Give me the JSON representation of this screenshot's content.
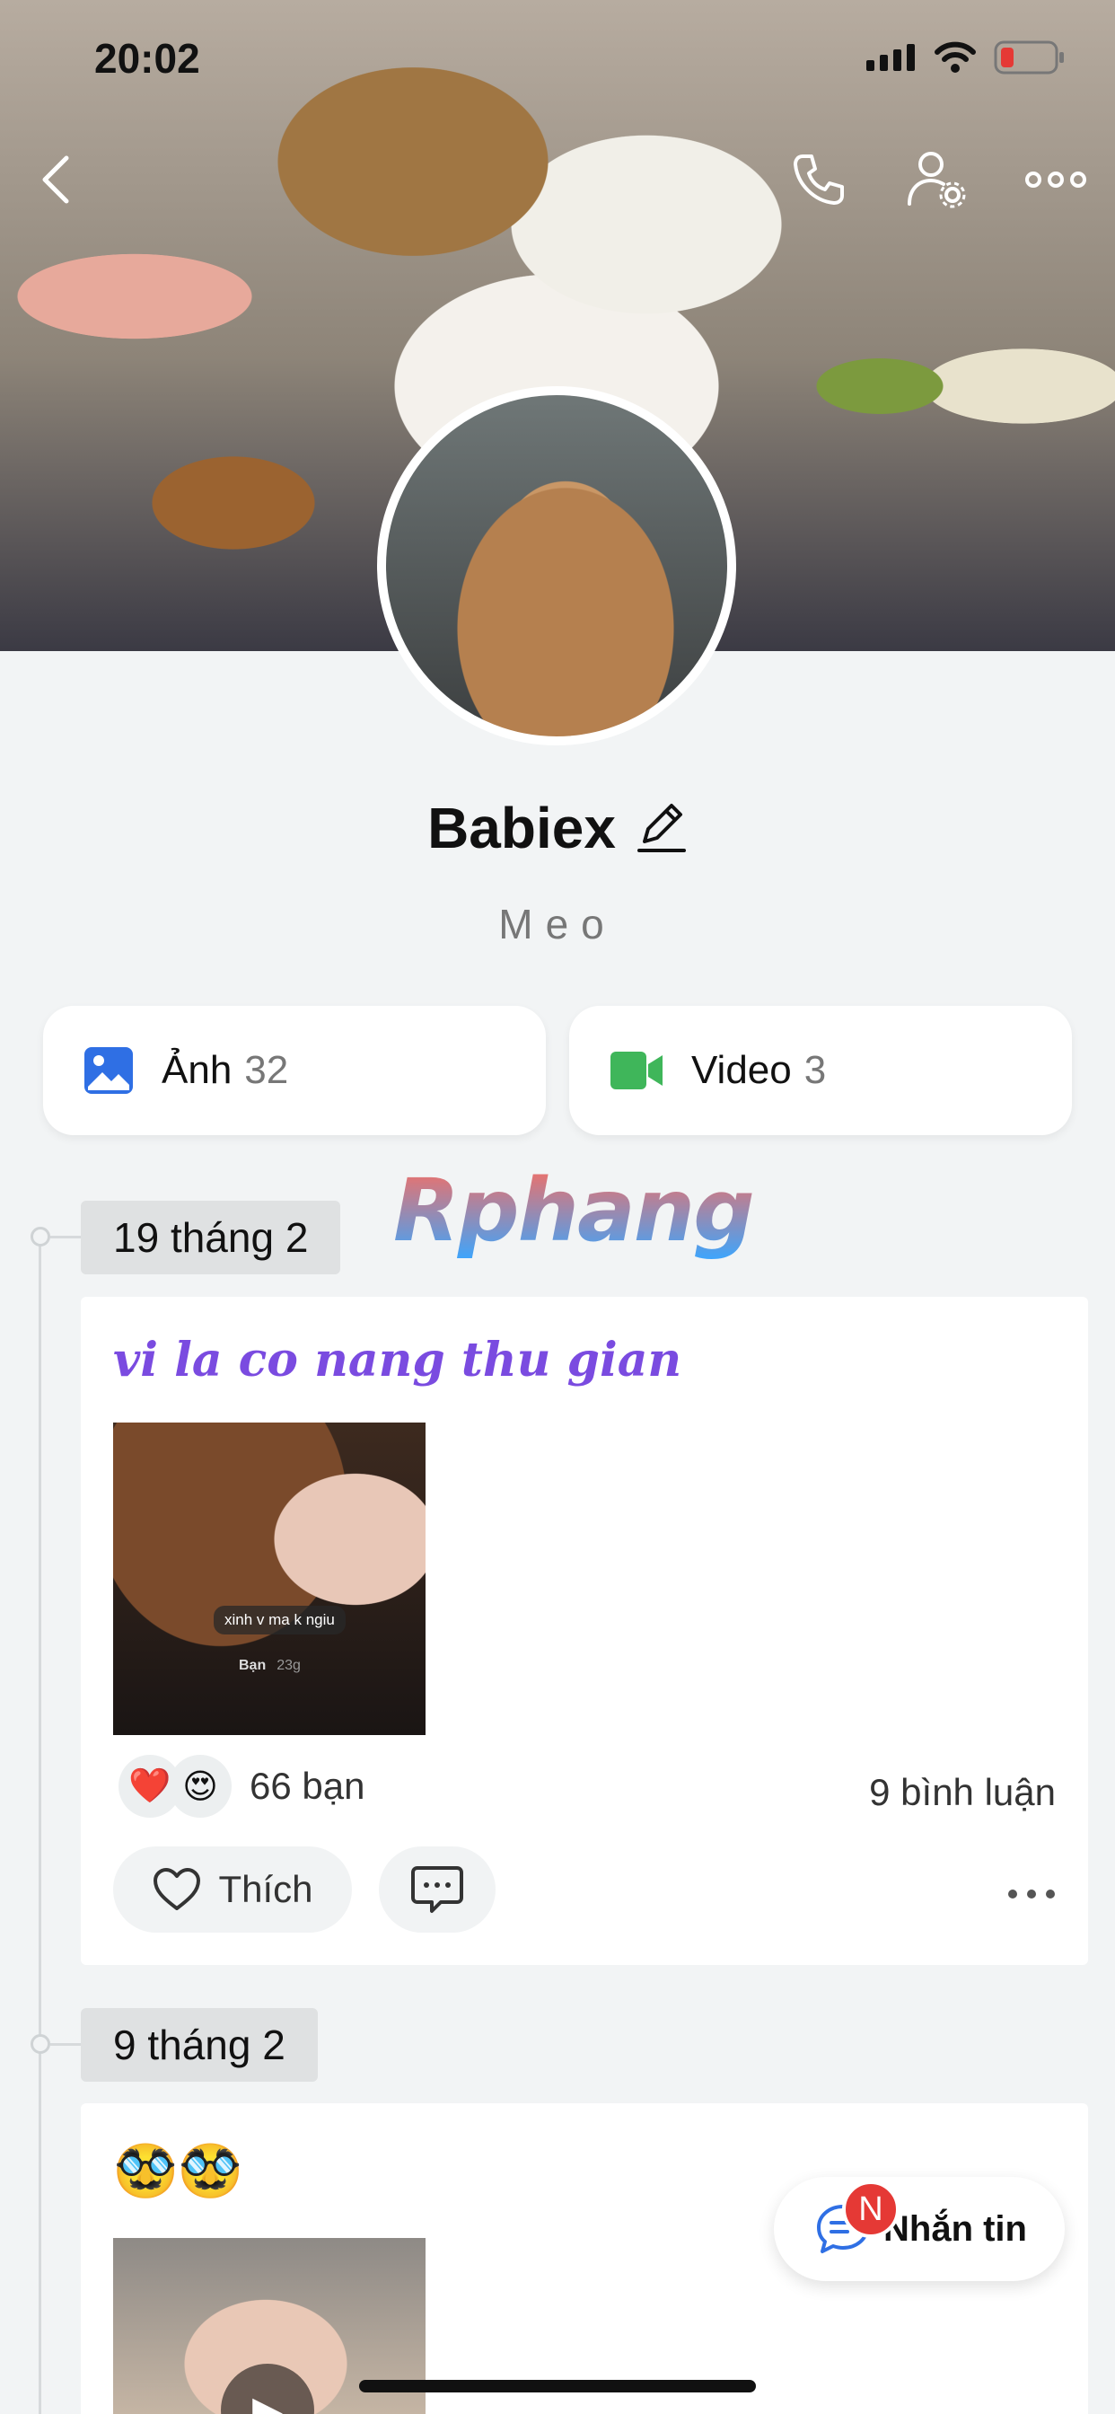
{
  "status_bar": {
    "time": "20:02"
  },
  "profile": {
    "name": "Babiex",
    "bio": "Meo"
  },
  "media": {
    "photos": {
      "label": "Ảnh",
      "count": "32"
    },
    "videos": {
      "label": "Video",
      "count": "3"
    }
  },
  "watermark": "Rphang",
  "posts": [
    {
      "date": "19 tháng 2",
      "title": "vi la co nang thu gian",
      "image_caption": "xinh v ma k ngiu",
      "image_author": "Bạn",
      "image_time": "23g",
      "reactions": [
        "❤️",
        "😍"
      ],
      "reaction_count": "66 bạn",
      "comment_count": "9 bình luận",
      "like_label": "Thích"
    },
    {
      "date": "9 tháng 2",
      "text": "🥸🥸"
    }
  ],
  "chat_button": {
    "label": "Nhắn tin",
    "badge": "N"
  },
  "colors": {
    "accent_blue": "#2f6fe4",
    "video_green": "#3fb65a",
    "title_purple": "#7a4be0",
    "badge_red": "#e53935"
  }
}
